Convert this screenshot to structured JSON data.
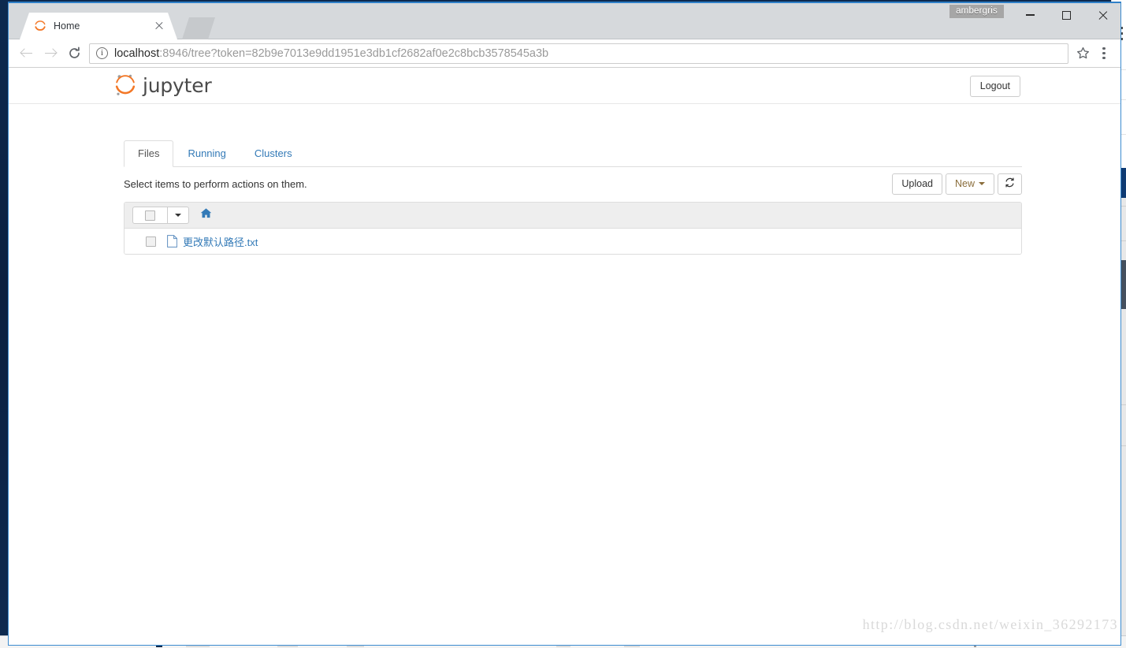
{
  "desktop": {
    "session_badge": "ambergris",
    "watermark": "http://blog.csdn.net/weixin_36292173"
  },
  "browser": {
    "tab": {
      "title": "Home",
      "favicon": "jupyter-favicon",
      "close_icon": "close-icon"
    },
    "new_tab_icon": "new-tab-icon",
    "window_controls": {
      "minimize": "minimize-icon",
      "maximize": "maximize-icon",
      "close": "close-icon"
    },
    "toolbar": {
      "back_icon": "arrow-left-icon",
      "forward_icon": "arrow-right-icon",
      "reload_icon": "reload-icon",
      "info_icon": "info-circle-icon",
      "bookmark_icon": "star-icon",
      "menu_icon": "three-dot-menu-icon",
      "url_host": "localhost",
      "url_rest": ":8946/tree?token=82b9e7013e9dd1951e3db1cf2682af0e2c8bcb3578545a3b",
      "url_full": "localhost:8946/tree?token=82b9e7013e9dd1951e3db1cf2682af0e2c8bcb3578545a3b"
    }
  },
  "jupyter": {
    "brand": {
      "logo_icon": "jupyter-logo-icon",
      "text": "jupyter"
    },
    "logout_label": "Logout",
    "tabs": [
      {
        "label": "Files",
        "active": true
      },
      {
        "label": "Running",
        "active": false
      },
      {
        "label": "Clusters",
        "active": false
      }
    ],
    "select_hint": "Select items to perform actions on them.",
    "buttons": {
      "upload": "Upload",
      "new": "New",
      "new_caret_icon": "chevron-down-icon",
      "refresh_icon": "refresh-icon"
    },
    "list_toolbar": {
      "select_all_checkbox": "select-all-checkbox",
      "select_all_caret_icon": "chevron-down-icon",
      "breadcrumb_home_icon": "home-icon"
    },
    "files": [
      {
        "name": "更改默认路径.txt",
        "icon": "text-file-icon",
        "checkbox": "row-checkbox"
      }
    ]
  },
  "colors": {
    "accent_orange": "#f37726",
    "link_blue": "#337ab7",
    "desktop_blue": "#0b2545",
    "window_border": "#3b8bd0",
    "new_button_text": "#8a6d3b",
    "toolbar_grey": "#eeeeee"
  }
}
